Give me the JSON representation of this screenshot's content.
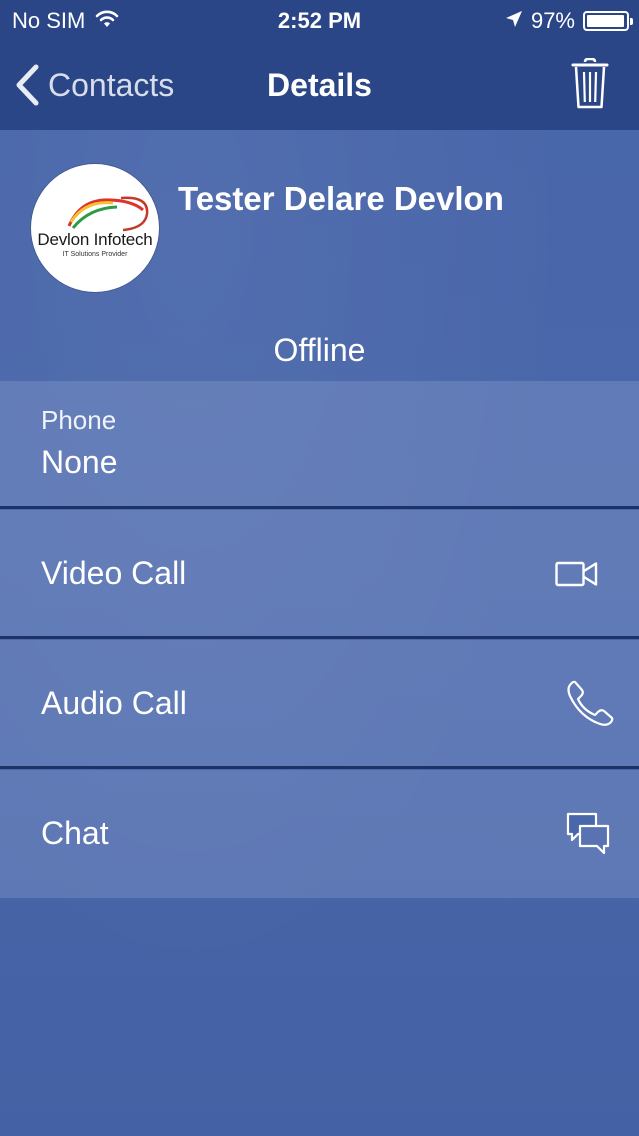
{
  "status_bar": {
    "carrier": "No SIM",
    "time": "2:52 PM",
    "battery": "97%",
    "battery_level": 0.97,
    "icons": [
      "wifi-icon",
      "location-arrow-icon",
      "battery-icon"
    ]
  },
  "nav": {
    "back_label": "Contacts",
    "title": "Details",
    "icons": [
      "chevron-left-icon",
      "trash-icon"
    ]
  },
  "contact": {
    "name": "Tester Delare Devlon",
    "presence": "Offline",
    "avatar_logo_text": "Devlon Infotech",
    "avatar_logo_subtext": "IT Solutions Provider"
  },
  "phone": {
    "label": "Phone",
    "value": "None"
  },
  "actions": [
    {
      "label": "Video Call",
      "icon": "video-camera-icon"
    },
    {
      "label": "Audio Call",
      "icon": "phone-icon"
    },
    {
      "label": "Chat",
      "icon": "chat-bubbles-icon"
    }
  ],
  "colors": {
    "bar_background": "#2b4687",
    "screen_background": "#4866aa",
    "divider": "#1d3368",
    "text": "#ffffff"
  }
}
